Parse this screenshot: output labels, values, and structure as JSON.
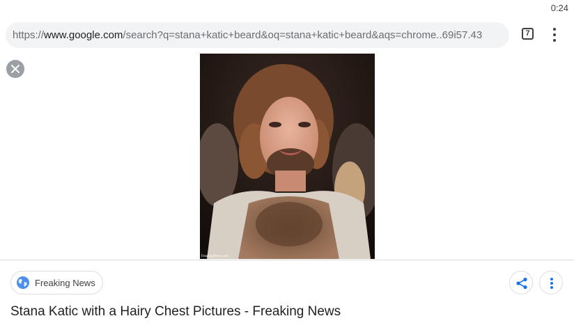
{
  "status_bar": {
    "time": "0:24"
  },
  "toolbar": {
    "url_scheme": "https://",
    "url_host": "www.google.com",
    "url_path": "/search?q=stana+katic+beard&oq=stana+katic+beard&aqs=chrome..69i57.43",
    "tab_count": "7",
    "tab_icon": "tab-switcher-icon",
    "menu_icon": "more-vert-icon"
  },
  "viewer": {
    "close_icon": "close-icon",
    "image_watermark": "FreakingNews.com"
  },
  "result": {
    "source_icon": "globe-icon",
    "source_name": "Freaking News",
    "title": "Stana Katic with a Hairy Chest Pictures - Freaking News",
    "share_icon": "share-icon",
    "more_icon": "more-vert-icon"
  },
  "colors": {
    "url_bar_bg": "#f1f3f4",
    "accent_blue": "#1a73e8",
    "close_button": "#9aa0a6"
  }
}
